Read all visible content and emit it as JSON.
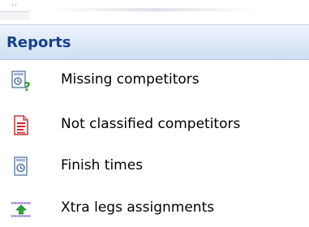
{
  "panel": {
    "title": "Reports",
    "items": [
      {
        "label": "Missing competitors",
        "icon": "report-question-icon"
      },
      {
        "label": "Not classified competitors",
        "icon": "red-document-icon"
      },
      {
        "label": "Finish times",
        "icon": "clock-document-icon"
      },
      {
        "label": "Xtra legs assignments",
        "icon": "green-up-arrow-icon"
      }
    ]
  }
}
